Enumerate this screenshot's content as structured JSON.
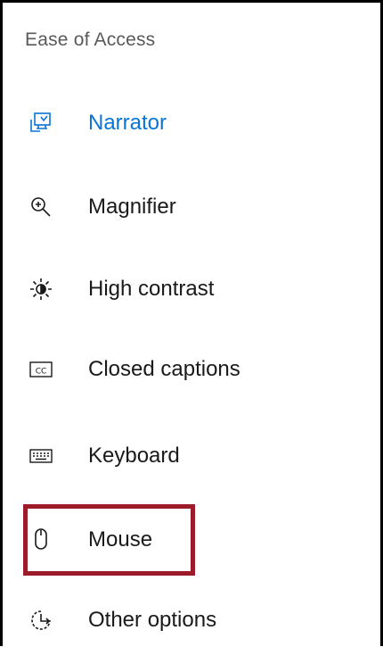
{
  "section_title": "Ease of Access",
  "nav": {
    "items": [
      {
        "label": "Narrator",
        "icon": "narrator-icon",
        "selected": true
      },
      {
        "label": "Magnifier",
        "icon": "magnifier-icon",
        "selected": false
      },
      {
        "label": "High contrast",
        "icon": "high-contrast-icon",
        "selected": false
      },
      {
        "label": "Closed captions",
        "icon": "closed-captions-icon",
        "selected": false
      },
      {
        "label": "Keyboard",
        "icon": "keyboard-icon",
        "selected": false
      },
      {
        "label": "Mouse",
        "icon": "mouse-icon",
        "selected": false
      },
      {
        "label": "Other options",
        "icon": "other-options-icon",
        "selected": false
      }
    ]
  },
  "highlight": {
    "target": "Mouse",
    "color": "#9b1b2a"
  },
  "colors": {
    "accent": "#0a74d6",
    "text": "#1a1a1a",
    "header": "#595959"
  },
  "icons": {
    "closed_captions_text": "CC"
  }
}
